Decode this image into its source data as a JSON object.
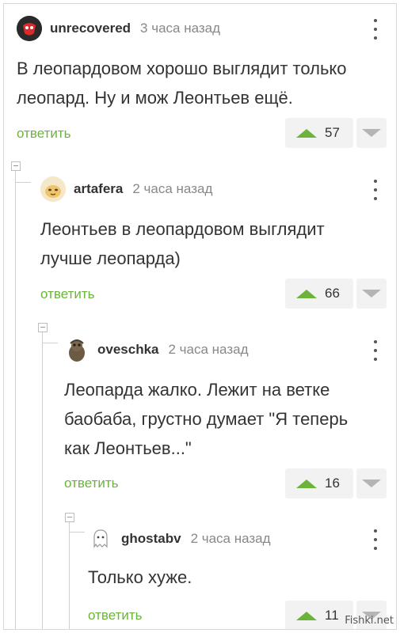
{
  "comments": [
    {
      "author": "unrecovered",
      "time": "3 часа назад",
      "text_lines": [
        "В леопардовом хорошо выглядит только",
        "леопард. Ну и мож Леонтьев ещё."
      ],
      "reply_label": "ответить",
      "votes": "57"
    },
    {
      "author": "artafera",
      "time": "2 часа назад",
      "text_lines": [
        "Леонтьев в леопардовом выглядит",
        "лучше леопарда)"
      ],
      "reply_label": "ответить",
      "votes": "66"
    },
    {
      "author": "oveschka",
      "time": "2 часа назад",
      "text_lines": [
        "Леопарда жалко. Лежит на ветке",
        "баобаба, грустно думает \"Я теперь",
        "как Леонтьев...\""
      ],
      "reply_label": "ответить",
      "votes": "16"
    },
    {
      "author": "ghostabv",
      "time": "2 часа назад",
      "text_lines": [
        "Только хуже."
      ],
      "reply_label": "ответить",
      "votes": "11"
    }
  ],
  "watermark": "Fishki.net",
  "colors": {
    "accent": "#6cb33b",
    "muted": "#888888",
    "text": "#333333"
  }
}
